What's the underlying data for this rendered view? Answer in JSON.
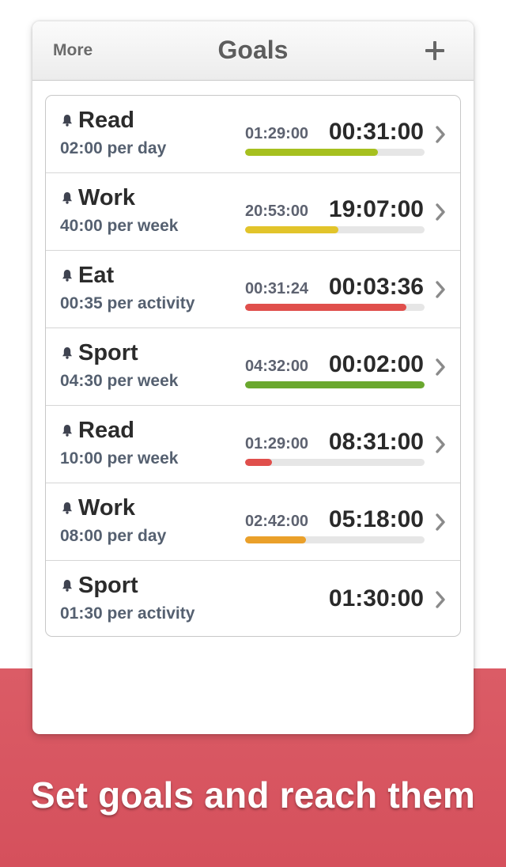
{
  "navbar": {
    "more_label": "More",
    "title": "Goals",
    "add_icon": "plus-icon"
  },
  "goals": [
    {
      "name": "Read",
      "target": "02:00 per day",
      "done": "01:29:00",
      "left": "00:31:00",
      "progress": 0.74,
      "color": "#a6c01f"
    },
    {
      "name": "Work",
      "target": "40:00 per week",
      "done": "20:53:00",
      "left": "19:07:00",
      "progress": 0.52,
      "color": "#e2c42a"
    },
    {
      "name": "Eat",
      "target": "00:35 per activity",
      "done": "00:31:24",
      "left": "00:03:36",
      "progress": 0.9,
      "color": "#e04f4c"
    },
    {
      "name": "Sport",
      "target": "04:30 per week",
      "done": "04:32:00",
      "left": "00:02:00",
      "progress": 1.0,
      "color": "#6aa82e"
    },
    {
      "name": "Read",
      "target": "10:00 per week",
      "done": "01:29:00",
      "left": "08:31:00",
      "progress": 0.15,
      "color": "#e04f4c"
    },
    {
      "name": "Work",
      "target": "08:00 per day",
      "done": "02:42:00",
      "left": "05:18:00",
      "progress": 0.34,
      "color": "#eaa02a"
    },
    {
      "name": "Sport",
      "target": "01:30 per activity",
      "done": "",
      "left": "01:30:00",
      "progress": null,
      "color": ""
    }
  ],
  "icons": {
    "reminder": "bell-icon",
    "disclosure": "chevron-right-icon"
  },
  "banner": {
    "tagline": "Set goals and reach them",
    "background_color": "#d8545f"
  }
}
